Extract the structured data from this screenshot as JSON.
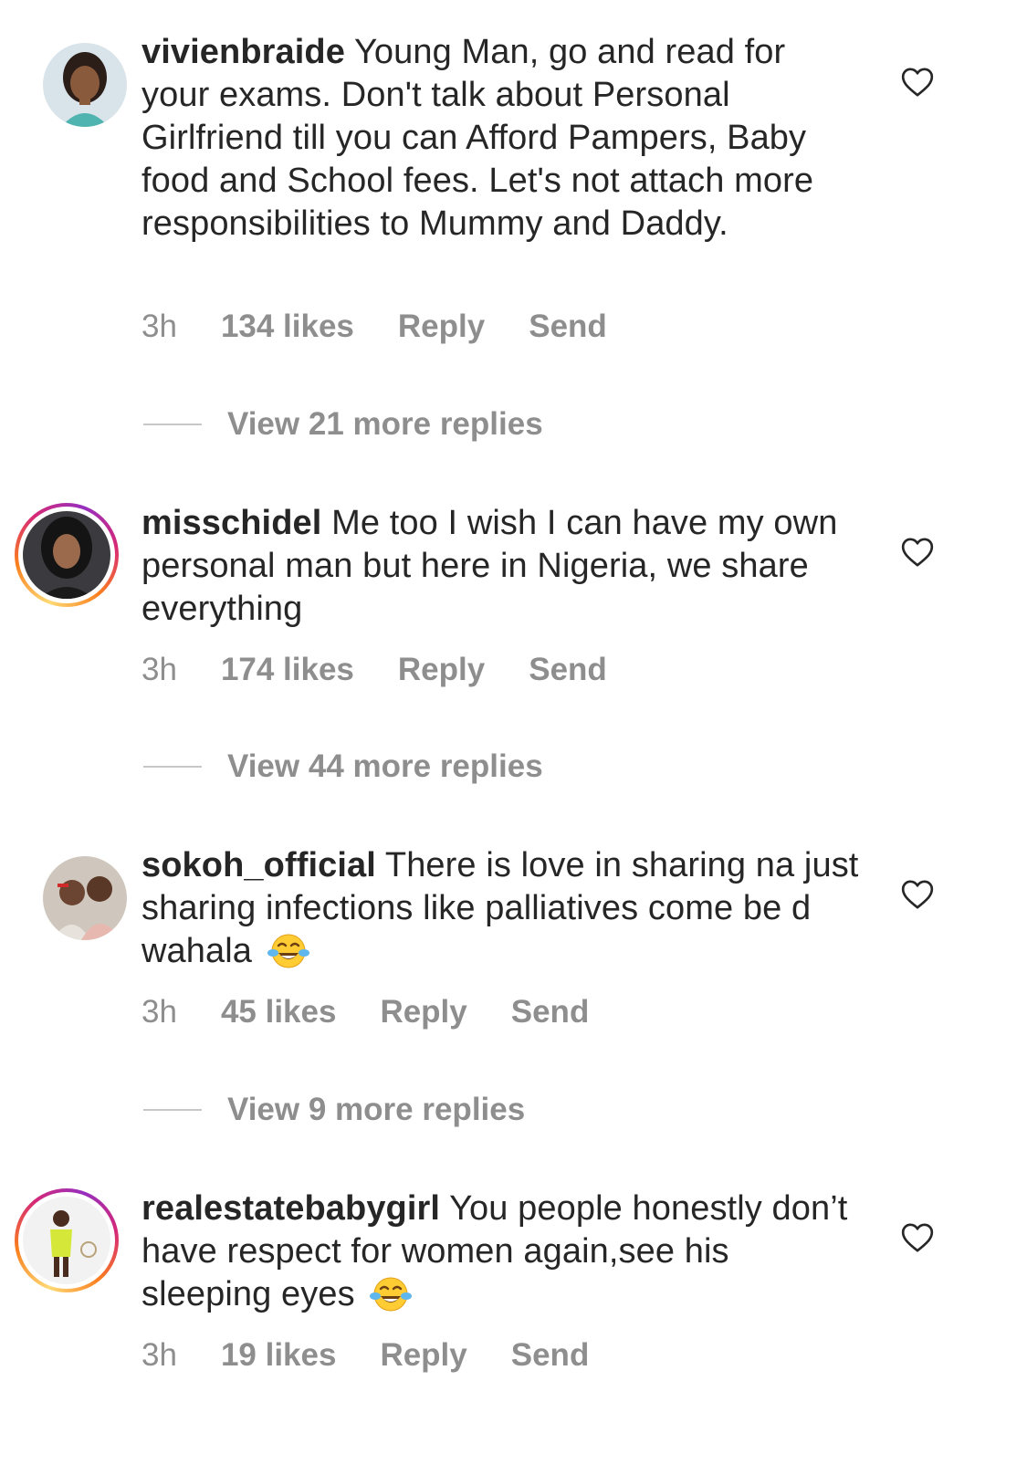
{
  "comments": [
    {
      "username": "vivienbraide",
      "text": "Young Man, go and read for your exams. Don't talk about Personal Girlfriend till you can Afford Pampers, Baby food and School fees. Let's not attach more responsibilities to Mummy and Daddy.",
      "time": "3h",
      "likes": "134 likes",
      "reply": "Reply",
      "send": "Send",
      "view_replies": "View 21 more replies",
      "has_story_ring": false,
      "emoji": ""
    },
    {
      "username": "misschidel",
      "text": "Me too I wish I can have my own personal man but here in Nigeria, we share everything",
      "time": "3h",
      "likes": "174 likes",
      "reply": "Reply",
      "send": "Send",
      "view_replies": "View 44 more replies",
      "has_story_ring": true,
      "emoji": ""
    },
    {
      "username": "sokoh_official",
      "text": "There is love in sharing na just sharing infections like palliatives come be d wahala",
      "time": "3h",
      "likes": "45 likes",
      "reply": "Reply",
      "send": "Send",
      "view_replies": "View 9 more replies",
      "has_story_ring": false,
      "emoji": "face-with-tears-of-joy"
    },
    {
      "username": "realestatebabygirl",
      "text": "You people honestly don’t have respect for women again,see his sleeping eyes",
      "time": "3h",
      "likes": "19 likes",
      "reply": "Reply",
      "send": "Send",
      "has_story_ring": true,
      "emoji": "face-with-tears-of-joy"
    }
  ],
  "colors": {
    "text": "#262626",
    "meta": "#8e8e8e",
    "divider": "#c7c7c7",
    "ring_gradient": [
      "#feda75",
      "#fa7e1e",
      "#d62976",
      "#962fbf"
    ]
  },
  "icons": {
    "like": "heart-outline-icon",
    "emoji": "face-with-tears-of-joy"
  }
}
